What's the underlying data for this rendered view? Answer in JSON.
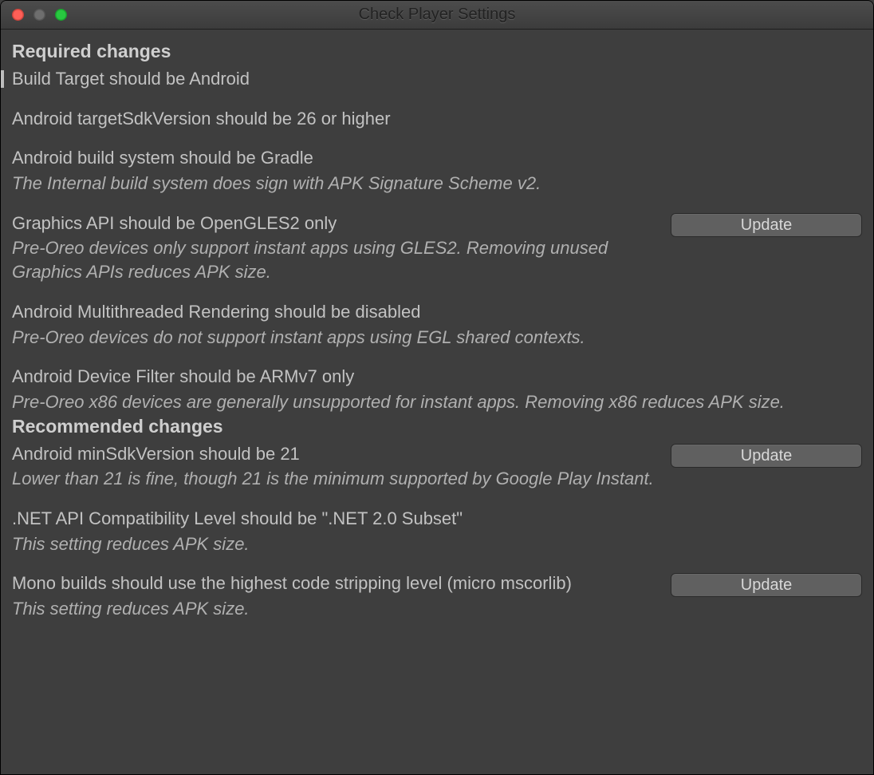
{
  "window": {
    "title": "Check Player Settings"
  },
  "buttons": {
    "update_label": "Update"
  },
  "sections": {
    "required_header": "Required changes",
    "recommended_header": "Recommended changes"
  },
  "required": {
    "build_target": {
      "title": "Build Target should be Android"
    },
    "target_sdk": {
      "title": "Android targetSdkVersion should be 26 or higher"
    },
    "build_system": {
      "title": "Android build system should be Gradle",
      "note": "The Internal build system does sign with APK Signature Scheme v2."
    },
    "graphics_api": {
      "title": "Graphics API should be OpenGLES2 only",
      "note": "Pre-Oreo devices only support instant apps using GLES2. Removing unused Graphics APIs reduces APK size.",
      "has_update": true
    },
    "mt_rendering": {
      "title": "Android Multithreaded Rendering should be disabled",
      "note": "Pre-Oreo devices do not support instant apps using EGL shared contexts."
    },
    "device_filter": {
      "title": "Android Device Filter should be ARMv7 only",
      "note": "Pre-Oreo x86 devices are generally unsupported for instant apps. Removing x86 reduces APK size."
    }
  },
  "recommended": {
    "min_sdk": {
      "title": "Android minSdkVersion should be 21",
      "note": "Lower than 21 is fine, though 21 is the minimum supported by Google Play Instant.",
      "has_update": true
    },
    "net_api": {
      "title": ".NET API Compatibility Level should be \".NET 2.0 Subset\"",
      "note": "This setting reduces APK size."
    },
    "mono_stripping": {
      "title": "Mono builds should use the highest code stripping level (micro mscorlib)",
      "note": "This setting reduces APK size.",
      "has_update": true
    }
  }
}
